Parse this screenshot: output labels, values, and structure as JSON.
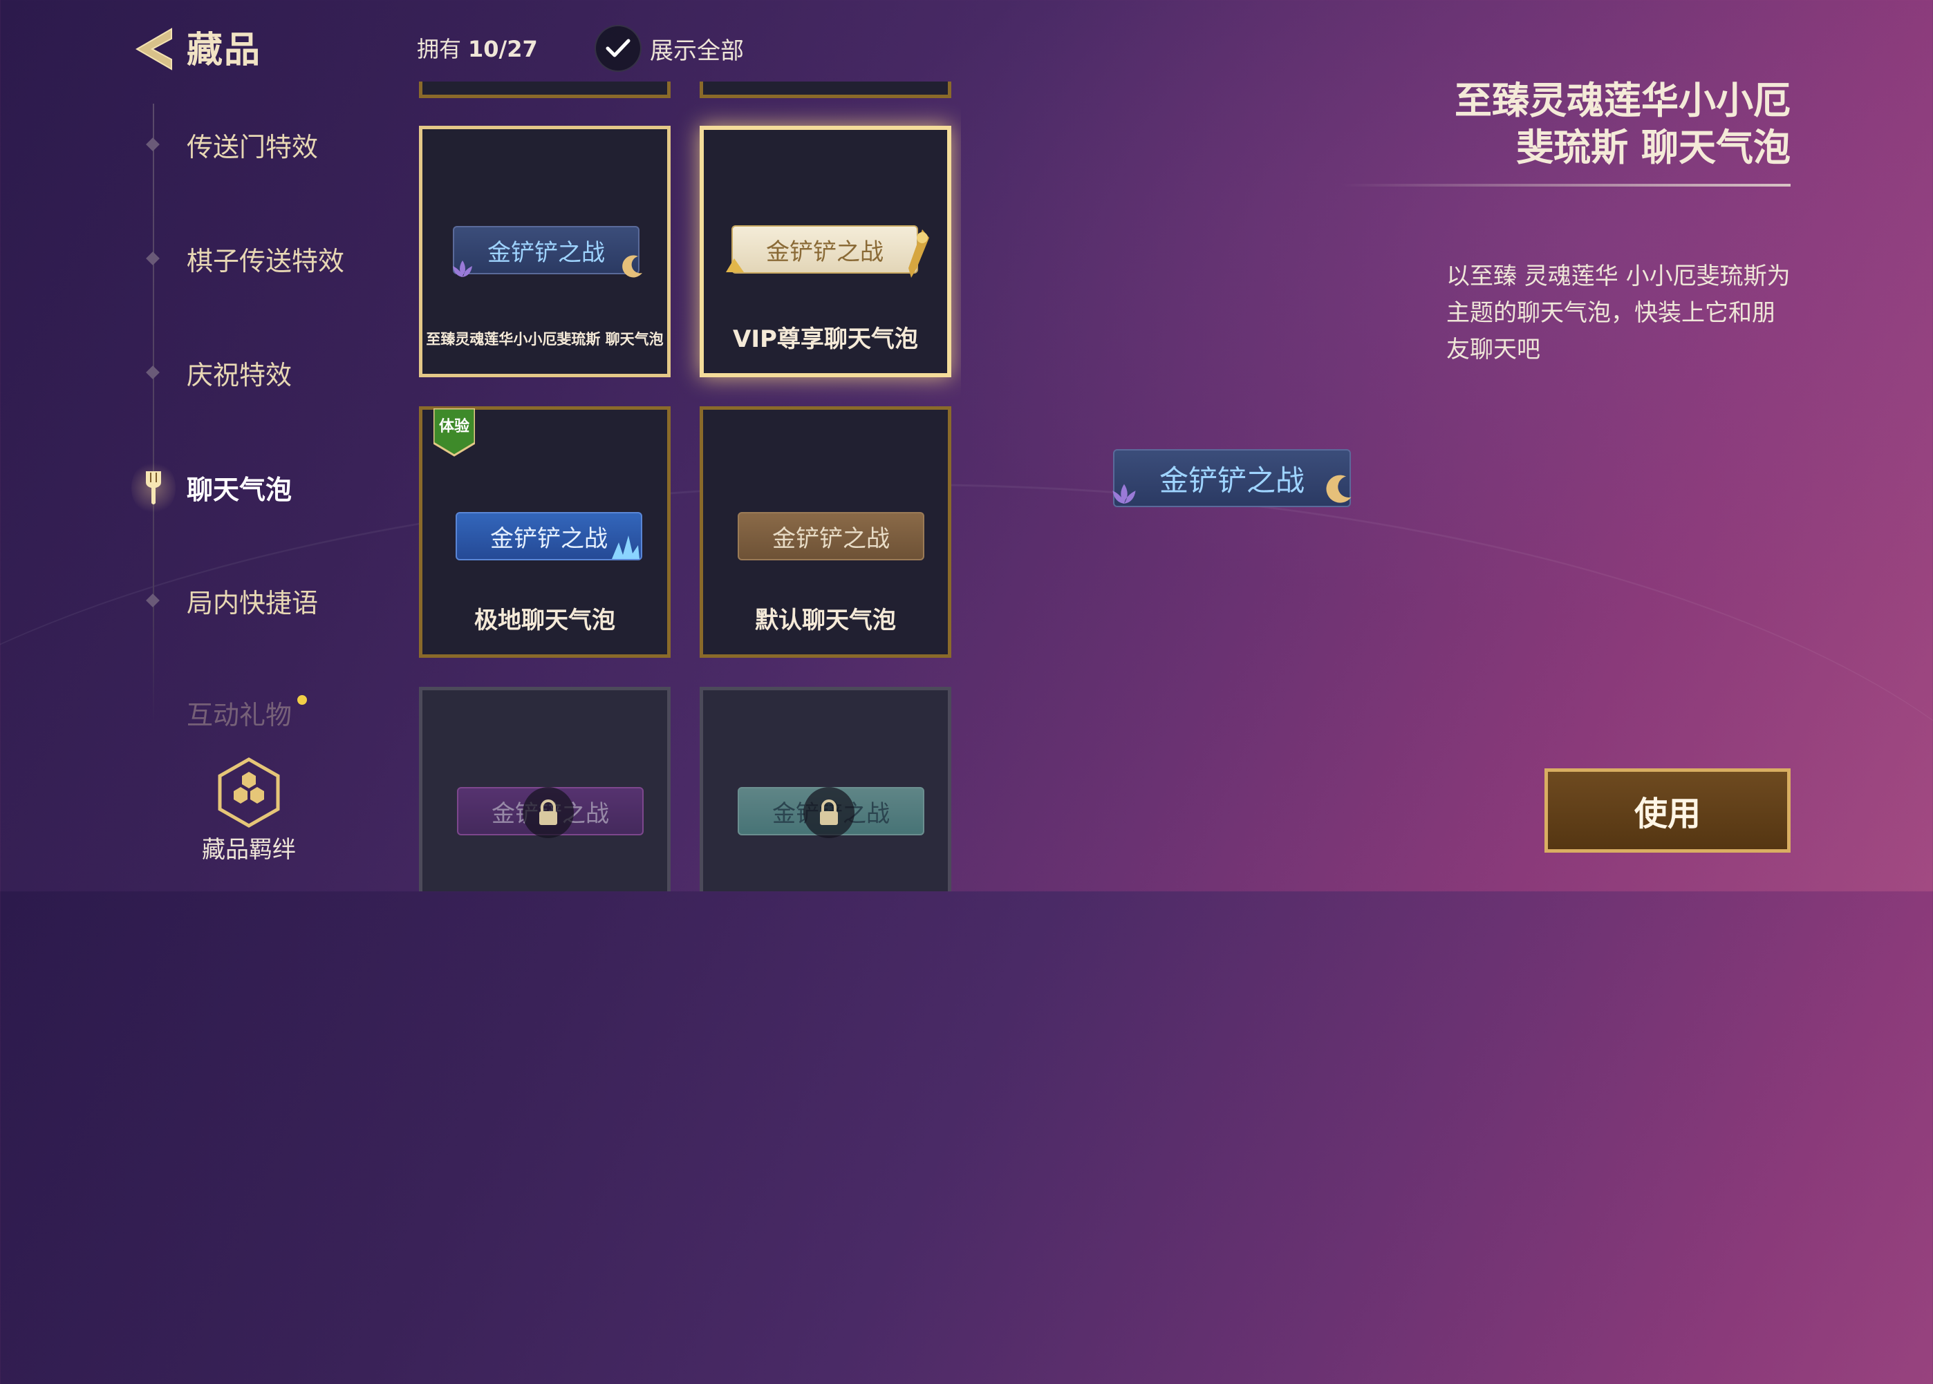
{
  "header": {
    "title": "藏品",
    "owned_label": "拥有",
    "owned_count": "10/27",
    "show_all_label": "展示全部"
  },
  "sidebar": {
    "items": [
      {
        "label": "传送门特效"
      },
      {
        "label": "棋子传送特效"
      },
      {
        "label": "庆祝特效"
      },
      {
        "label": "聊天气泡",
        "active": true
      },
      {
        "label": "局内快捷语"
      },
      {
        "label": "互动礼物"
      }
    ],
    "bond_label": "藏品羁绊"
  },
  "cards": [
    {
      "name": "至臻灵魂莲华小小厄斐琉斯  聊天气泡",
      "bubble_text": "金铲铲之战",
      "style": "blue"
    },
    {
      "name": "VIP尊享聊天气泡",
      "bubble_text": "金铲铲之战",
      "style": "cream",
      "selected": true
    },
    {
      "name": "极地聊天气泡",
      "bubble_text": "金铲铲之战",
      "style": "ice",
      "badge": "体验"
    },
    {
      "name": "默认聊天气泡",
      "bubble_text": "金铲铲之战",
      "style": "brown"
    },
    {
      "name": "",
      "bubble_text": "金铲铲之战",
      "style": "purple",
      "locked": true
    },
    {
      "name": "",
      "bubble_text": "金铲铲之战",
      "style": "teal",
      "locked": true
    }
  ],
  "detail": {
    "title_line1": "至臻灵魂莲华小小厄",
    "title_line2": "斐琉斯 聊天气泡",
    "description": "以至臻 灵魂莲华 小小厄斐琉斯为主题的聊天气泡，快装上它和朋友聊天吧",
    "preview_text": "金铲铲之战",
    "use_button": "使用"
  },
  "colors": {
    "accent_gold": "#d9ae62",
    "text_cream": "#efe6d8"
  }
}
